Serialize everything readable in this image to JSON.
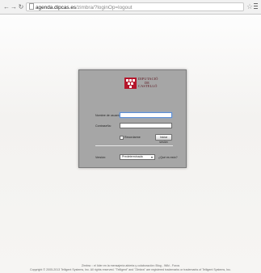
{
  "browser": {
    "url_host": "agenda.dipcas.es",
    "url_path": "/zimbra/?loginOp=logout",
    "icons": [
      "back-icon",
      "forward-icon",
      "reload-icon",
      "page-icon",
      "star-icon",
      "menu-icon"
    ]
  },
  "login": {
    "logo_lines": [
      "DIPUTACIÓ",
      "DE",
      "CASTELLÓ"
    ],
    "username_label": "Nombre de usuario:",
    "password_label": "Contraseña:",
    "username_value": "",
    "password_value": "",
    "remember_label": "Recordarme",
    "submit_label": "Iniciar sesión",
    "version_label": "Versión:",
    "version_selected": "Predeterminada",
    "help_link": "¿Qué es esto?",
    "brand_color": "#b5162b"
  },
  "footer": {
    "line1": "Zimbra :: el líder en la mensajería abierta y colaboración: Blog - Wiki - Foros",
    "line2": "Copyright © 2005-2013 Telligent Systems, Inc. All rights reserved. \"Telligent\" and \"Zimbra\" are registered trademarks or trademarks of Telligent Systems, Inc."
  }
}
